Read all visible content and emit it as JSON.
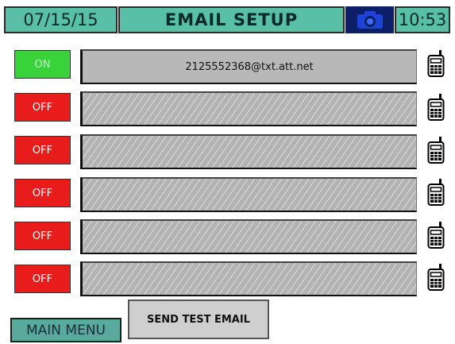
{
  "header": {
    "date": "07/15/15",
    "title": "EMAIL SETUP",
    "camera_icon": "camera-icon",
    "time": "10:53"
  },
  "rows": [
    {
      "toggle": "ON",
      "address": "2125552368@txt.att.net",
      "icon": "phone-icon"
    },
    {
      "toggle": "OFF",
      "address": "",
      "icon": "phone-icon"
    },
    {
      "toggle": "OFF",
      "address": "",
      "icon": "phone-icon"
    },
    {
      "toggle": "OFF",
      "address": "",
      "icon": "phone-icon"
    },
    {
      "toggle": "OFF",
      "address": "",
      "icon": "phone-icon"
    },
    {
      "toggle": "OFF",
      "address": "",
      "icon": "phone-icon"
    }
  ],
  "footer": {
    "main_menu": "MAIN MENU",
    "send_test": "SEND TEST EMAIL"
  },
  "colors": {
    "header_bg": "#59bfa7",
    "on": "#39d23b",
    "off": "#e91c1c",
    "camera_bg": "#0d1f66"
  }
}
